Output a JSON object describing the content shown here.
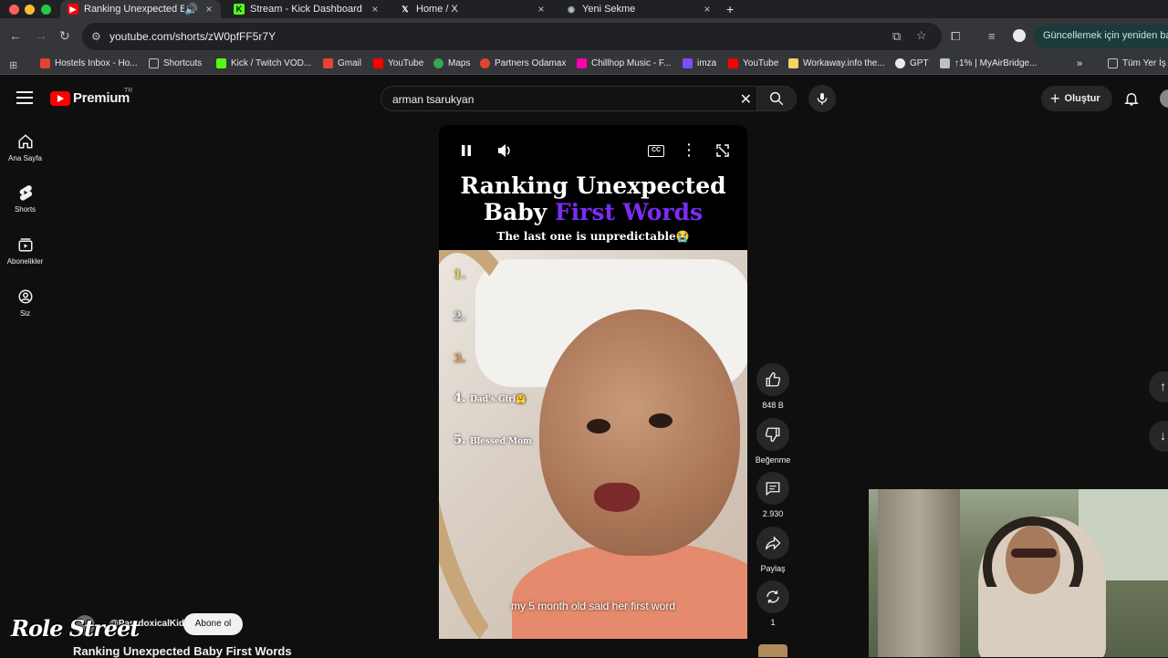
{
  "browser": {
    "tabs": [
      {
        "title": "Ranking Unexpected Baby",
        "active": true
      },
      {
        "title": "Stream - Kick Dashboard",
        "active": false
      },
      {
        "title": "Home / X",
        "active": false
      },
      {
        "title": "Yeni Sekme",
        "active": false
      }
    ],
    "url": "youtube.com/shorts/zW0pfFF5r7Y",
    "update_label": "Güncellemek için yeniden başl",
    "bookmarks": [
      "Hostels Inbox - Ho...",
      "Shortcuts",
      "Kick / Twitch VOD...",
      "Gmail",
      "YouTube",
      "Maps",
      "Partners Odamax",
      "Chillhop Music - F...",
      "imza",
      "YouTube",
      "Workaway.info the...",
      "GPT",
      "↑1% | MyAirBridge...",
      "Tüm Yer İş"
    ]
  },
  "youtube": {
    "logo": "Premium",
    "region": "TR",
    "search_query": "arman tsarukyan",
    "create_label": "Oluştur",
    "sidebar": [
      {
        "label": "Ana Sayfa",
        "icon": "home-icon"
      },
      {
        "label": "Shorts",
        "icon": "shorts-icon"
      },
      {
        "label": "Abonelikler",
        "icon": "subscriptions-icon"
      },
      {
        "label": "Siz",
        "icon": "you-icon"
      }
    ]
  },
  "short": {
    "title_line1": "Ranking Unexpected",
    "title_line2_a": "Baby ",
    "title_line2_b": "First Words",
    "subtitle": "The last one is unpredictable😭",
    "ranks": [
      "1.",
      "2.",
      "3.",
      "4.",
      "5."
    ],
    "rank_labels": [
      "",
      "",
      "",
      "Dad's Girl🤗",
      "Blessed Mom"
    ],
    "caption": "my 5 month old said her first word",
    "accent_color": "#7b2cf5"
  },
  "actions": {
    "likes": "848 B",
    "dislike_label": "Beğenme",
    "comments": "2.930",
    "share_label": "Paylaş",
    "remix_count": "1"
  },
  "channel": {
    "name": "@ParadoxicalKid",
    "subscribe_label": "Abone ol",
    "bottom_title": "Ranking Unexpected Baby First Words"
  },
  "overlay": {
    "logo_text": "Role Street"
  }
}
